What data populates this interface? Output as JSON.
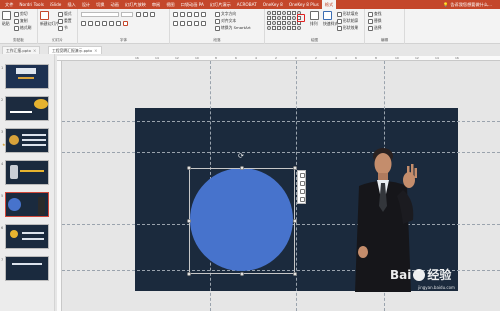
{
  "menubar": {
    "tabs": [
      {
        "label": "文件",
        "active": false
      },
      {
        "label": "Nordri Tools",
        "active": false
      },
      {
        "label": "iSlide",
        "active": false
      },
      {
        "label": "插入",
        "active": false
      },
      {
        "label": "设计",
        "active": false
      },
      {
        "label": "切换",
        "active": false
      },
      {
        "label": "动画",
        "active": false
      },
      {
        "label": "幻灯片放映",
        "active": false
      },
      {
        "label": "审阅",
        "active": false
      },
      {
        "label": "视图",
        "active": false
      },
      {
        "label": "口袋动画 PA",
        "active": false
      },
      {
        "label": "幻灯片演示",
        "active": false
      },
      {
        "label": "ACROBAT",
        "active": false
      },
      {
        "label": "OneKey 8",
        "active": false
      },
      {
        "label": "OneKey 8 Plus",
        "active": false
      },
      {
        "label": "格式",
        "active": true
      }
    ],
    "tell_me": "告诉我您想要做什么..."
  },
  "ribbon": {
    "group_labels": {
      "clipboard": "剪贴板",
      "slides": "幻灯片",
      "font": "字体",
      "paragraph": "段落",
      "drawing": "绘图",
      "editing": "编辑"
    },
    "clipboard": {
      "paste": "粘贴",
      "cut": "剪切",
      "copy": "复制",
      "format_painter": "格式刷"
    },
    "slides": {
      "new_slide": "新建幻灯片",
      "layout": "版式",
      "reset": "重置",
      "section": "节"
    },
    "paragraph": {
      "text_direction": "文字方向",
      "align_text": "对齐文本",
      "smartart": "转换为 SmartArt"
    },
    "drawing": {
      "arrange": "排列",
      "quick_styles": "快速样式",
      "shape_fill": "形状填充",
      "shape_outline": "形状轮廓",
      "shape_effects": "形状效果"
    },
    "editing": {
      "find": "查找",
      "replace": "替换",
      "select": "选择"
    }
  },
  "doc_tabs": [
    {
      "label": "工作汇报.pptx",
      "active": false
    },
    {
      "label": "工程竞聘汇报演示.pptx",
      "active": true
    }
  ],
  "thumbnails": [
    "1",
    "2",
    "3",
    "4",
    "5",
    "6",
    "7"
  ],
  "ruler": {
    "h_numbers": [
      "16",
      "14",
      "12",
      "10",
      "8",
      "6",
      "4",
      "2",
      "0",
      "2",
      "4",
      "6",
      "8",
      "10",
      "12",
      "14",
      "16"
    ]
  },
  "slide": {
    "background": "#1b2a3d",
    "circle_color": "#4773cc"
  },
  "watermark": {
    "brand": "Bai",
    "brand_suffix": "经验",
    "url": "jingyan.baidu.com"
  },
  "colors": {
    "accent": "#c4472b",
    "ribbon": "#f3f3f3",
    "selection_highlight": "#e02020"
  }
}
